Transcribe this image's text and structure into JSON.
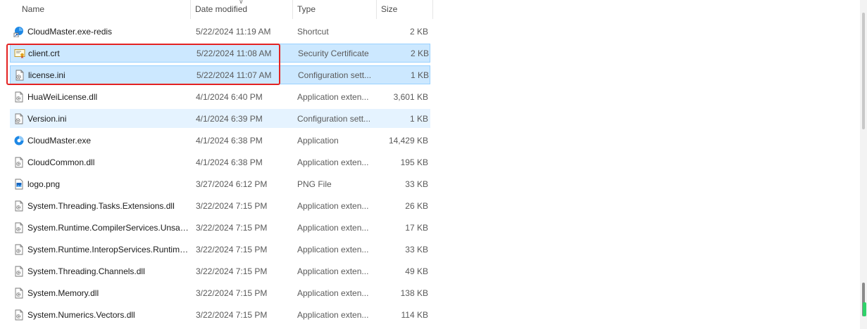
{
  "columns": {
    "name": "Name",
    "date": "Date modified",
    "type": "Type",
    "size": "Size"
  },
  "files": [
    {
      "name": "CloudMaster.exe-redis",
      "date": "5/22/2024 11:19 AM",
      "type": "Shortcut",
      "size": "2 KB",
      "icon": "shortcut-app-icon",
      "state": "normal"
    },
    {
      "name": "client.crt",
      "date": "5/22/2024 11:08 AM",
      "type": "Security Certificate",
      "size": "2 KB",
      "icon": "certificate-icon",
      "state": "selected"
    },
    {
      "name": "license.ini",
      "date": "5/22/2024 11:07 AM",
      "type": "Configuration sett...",
      "size": "1 KB",
      "icon": "settings-file-icon",
      "state": "selected"
    },
    {
      "name": "HuaWeiLicense.dll",
      "date": "4/1/2024 6:40 PM",
      "type": "Application exten...",
      "size": "3,601 KB",
      "icon": "dll-file-icon",
      "state": "normal"
    },
    {
      "name": "Version.ini",
      "date": "4/1/2024 6:39 PM",
      "type": "Configuration sett...",
      "size": "1 KB",
      "icon": "settings-file-icon",
      "state": "hover"
    },
    {
      "name": "CloudMaster.exe",
      "date": "4/1/2024 6:38 PM",
      "type": "Application",
      "size": "14,429 KB",
      "icon": "app-icon",
      "state": "normal"
    },
    {
      "name": "CloudCommon.dll",
      "date": "4/1/2024 6:38 PM",
      "type": "Application exten...",
      "size": "195 KB",
      "icon": "dll-file-icon",
      "state": "normal"
    },
    {
      "name": "logo.png",
      "date": "3/27/2024 6:12 PM",
      "type": "PNG File",
      "size": "33 KB",
      "icon": "image-file-icon",
      "state": "normal"
    },
    {
      "name": "System.Threading.Tasks.Extensions.dll",
      "date": "3/22/2024 7:15 PM",
      "type": "Application exten...",
      "size": "26 KB",
      "icon": "dll-file-icon",
      "state": "normal"
    },
    {
      "name": "System.Runtime.CompilerServices.Unsaf...",
      "date": "3/22/2024 7:15 PM",
      "type": "Application exten...",
      "size": "17 KB",
      "icon": "dll-file-icon",
      "state": "normal"
    },
    {
      "name": "System.Runtime.InteropServices.Runtime...",
      "date": "3/22/2024 7:15 PM",
      "type": "Application exten...",
      "size": "33 KB",
      "icon": "dll-file-icon",
      "state": "normal"
    },
    {
      "name": "System.Threading.Channels.dll",
      "date": "3/22/2024 7:15 PM",
      "type": "Application exten...",
      "size": "49 KB",
      "icon": "dll-file-icon",
      "state": "normal"
    },
    {
      "name": "System.Memory.dll",
      "date": "3/22/2024 7:15 PM",
      "type": "Application exten...",
      "size": "138 KB",
      "icon": "dll-file-icon",
      "state": "normal"
    },
    {
      "name": "System.Numerics.Vectors.dll",
      "date": "3/22/2024 7:15 PM",
      "type": "Application exten...",
      "size": "114 KB",
      "icon": "dll-file-icon",
      "state": "normal"
    }
  ],
  "colors": {
    "selected_bg": "#cce8ff",
    "hover_bg": "#e5f3ff",
    "highlight_border": "#e32222",
    "app_blue": "#1e88e5"
  }
}
